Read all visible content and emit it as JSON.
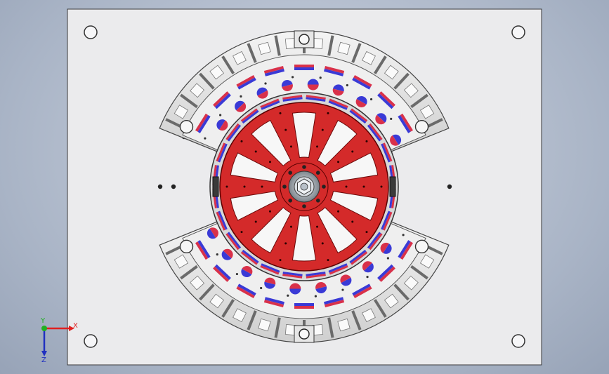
{
  "viewport": {
    "background": "#b3bdcd"
  },
  "plate": {
    "fill": "#ebebed",
    "stroke": "#3a3a3a"
  },
  "rotor": {
    "spoke_count": 10,
    "color": "#d42a2a",
    "window_color": "#f7f7f7",
    "hub_color": "#9aa0a6"
  },
  "stator": {
    "color": "#dcdcdc",
    "magnet_red": "#d9314a",
    "magnet_blue": "#3a3ad6",
    "magnet_count_per_arc": 9
  },
  "triad": {
    "x_label": "X",
    "y_label": "Y",
    "z_label": "Z",
    "x_color": "#e02020",
    "y_color": "#20b020",
    "z_color": "#2030c0"
  }
}
